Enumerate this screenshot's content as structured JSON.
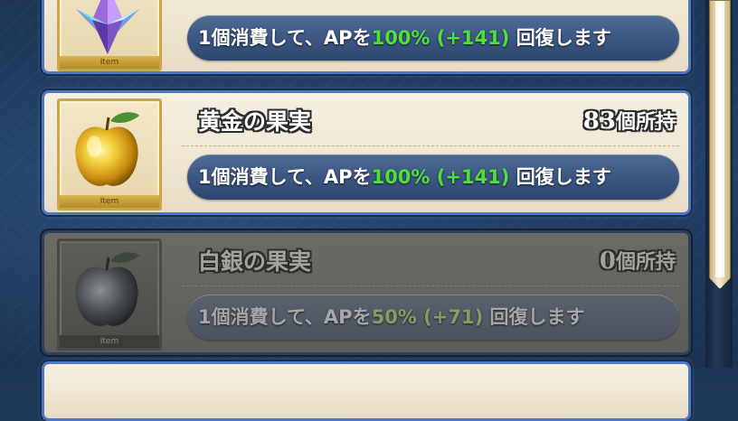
{
  "items": [
    {
      "name": "",
      "count_num": "",
      "count_suffix": "",
      "tag": "Item",
      "icon": "saint-quartz-crystal-icon",
      "desc_prefix": "1個消費して、APを",
      "desc_highlight": "100% (+141)",
      "desc_suffix": " 回復します",
      "enabled": true
    },
    {
      "name": "黄金の果実",
      "count_num": "83",
      "count_suffix": "個所持",
      "tag": "Item",
      "icon": "golden-apple-icon",
      "desc_prefix": "1個消費して、APを",
      "desc_highlight": "100% (+141)",
      "desc_suffix": " 回復します",
      "enabled": true
    },
    {
      "name": "白銀の果実",
      "count_num": "0",
      "count_suffix": "個所持",
      "tag": "Item",
      "icon": "silver-apple-icon",
      "desc_prefix": "1個消費して、APを",
      "desc_highlight": "50% (+71)",
      "desc_suffix": " 回復します",
      "enabled": false
    }
  ],
  "colors": {
    "highlight_green": "#4fe03c",
    "card_border": "#4f78c4",
    "desc_bar": "#3a5581"
  }
}
